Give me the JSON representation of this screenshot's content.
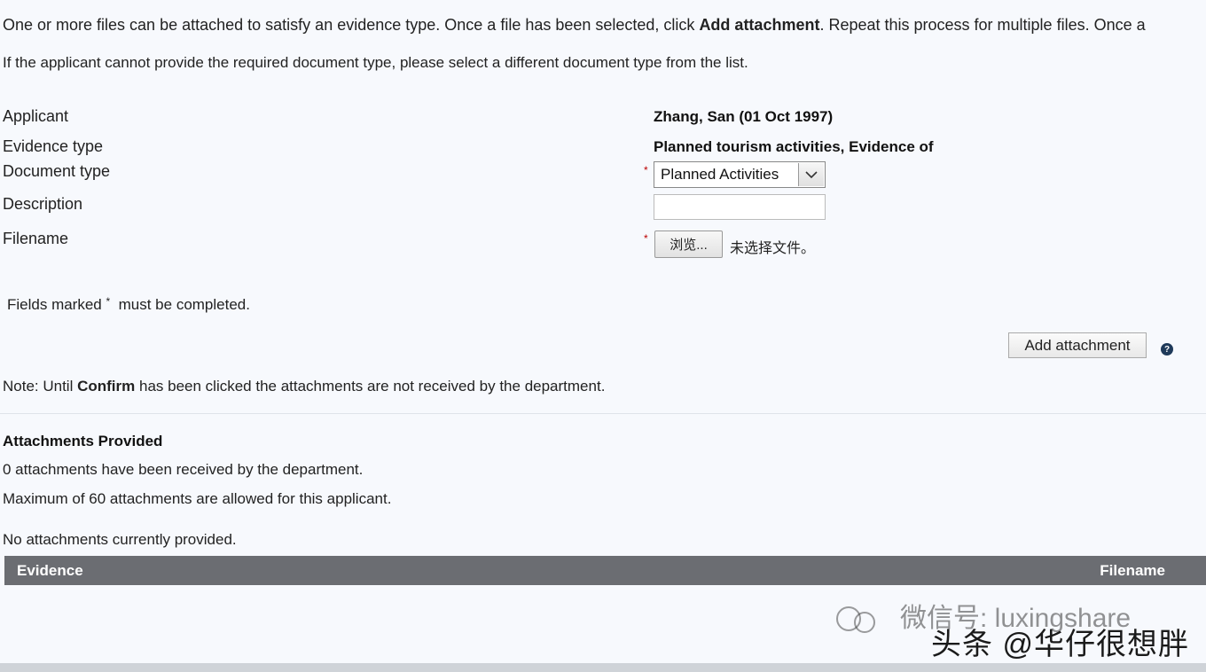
{
  "intro": {
    "line1_pre": "One or more files can be attached to satisfy an evidence type. Once a file has been selected, click ",
    "line1_bold": "Add attachment",
    "line1_post": ". Repeat this process for multiple files. Once a",
    "line2": "If the applicant cannot provide the required document type, please select a different document type from the list."
  },
  "form": {
    "applicant_label": "Applicant",
    "applicant_value": "Zhang, San (01 Oct 1997)",
    "evidence_type_label": "Evidence type",
    "evidence_type_value": "Planned tourism activities, Evidence of",
    "document_type_label": "Document type",
    "document_type_selected": "Planned Activities",
    "description_label": "Description",
    "description_value": "",
    "filename_label": "Filename",
    "browse_label": "浏览...",
    "no_file_text": "未选择文件。",
    "required_mark": "*"
  },
  "fields_note": {
    "pre": "Fields marked",
    "mark": "*",
    "post": "must be completed."
  },
  "add_attachment_label": "Add attachment",
  "help_icon_glyph": "?",
  "note": {
    "pre": "Note: Until ",
    "bold": "Confirm",
    "post": " has been clicked the attachments are not received by the department."
  },
  "attachments": {
    "heading": "Attachments Provided",
    "received": "0 attachments have been received by the department.",
    "maximum": "Maximum of 60 attachments are allowed for this applicant.",
    "none": "No attachments currently provided.",
    "col_evidence": "Evidence",
    "col_filename": "Filename"
  },
  "watermark": {
    "line1": "微信号: luxingshare",
    "line2": "头条 @华仔很想胖"
  }
}
